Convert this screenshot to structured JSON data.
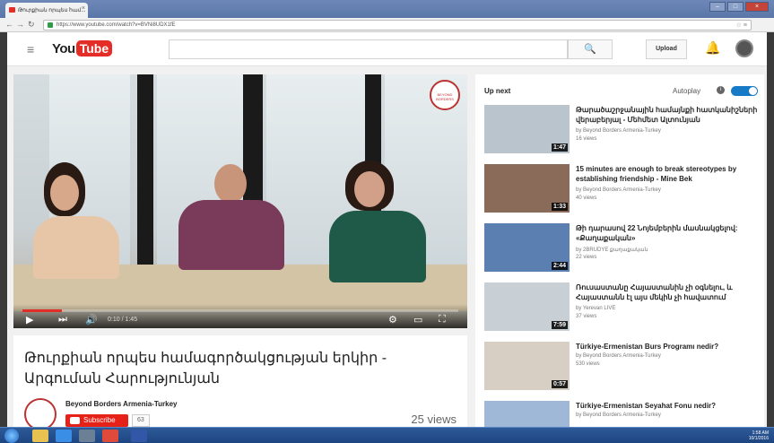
{
  "browser": {
    "tab_title": "Թուրքիան որպես համ...",
    "tab_close": "×",
    "url": "https://www.youtube.com/watch?v=BVNi8UDX1fE",
    "back_icon": "arrow-left-icon",
    "forward_icon": "arrow-right-icon",
    "reload_icon": "reload-icon",
    "window_controls": [
      "–",
      "□",
      "×"
    ]
  },
  "masthead": {
    "logo_you": "You",
    "logo_tube": "Tube",
    "search_placeholder": "",
    "search_icon": "🔍",
    "upload_label": "Upload",
    "bell_icon": "🔔"
  },
  "player": {
    "timecode": "0:10 / 1:45",
    "progress_fraction": 0.09,
    "watermark_text": "BEYOND BORDERS"
  },
  "video": {
    "title": "Թուրքիան որպես համագործակցության երկիր - Արգուման Հարությունյան",
    "channel_name": "Beyond Borders Armenia-Turkey",
    "subscribe_label": "Subscribe",
    "subscriber_count": "63",
    "views": "25 views"
  },
  "sidebar": {
    "upnext_label": "Up next",
    "autoplay_label": "Autoplay",
    "autoplay_on": true,
    "info_symbol": "i",
    "recommendations": [
      {
        "title": "Թարածաշրջանային համայնքի հատկանիշների վերաբերյալ - Մեհմետ Ալտունյան",
        "channel": "by Beyond Borders Armenia-Turkey",
        "views": "16 views",
        "duration": "1:47",
        "thumb_color": "#b9c4cc"
      },
      {
        "title": "15 minutes are enough to break stereotypes by establishing friendship - Mine Bek",
        "channel": "by Beyond Borders Armenia-Turkey",
        "views": "40 views",
        "duration": "1:33",
        "thumb_color": "#8a6a58"
      },
      {
        "title": "Թի դարասով 22 Նոյեմբերին մասնակցելով: «Քաղաքական»",
        "channel": "by 2BRUDYE քաղաքական",
        "views": "22 views",
        "duration": "2:44",
        "thumb_color": "#5a7fb0"
      },
      {
        "title": "Ռուսաստանը Հայաստանին չի օգնելու, և Հայաստանն էլ այս մեկին չի հավատում",
        "channel": "by Yerevan LIVE",
        "views": "37 views",
        "duration": "7:59",
        "thumb_color": "#c8d0d6"
      },
      {
        "title": "Türkiye-Ermenistan Burs Programı nedir?",
        "channel": "by Beyond Borders Armenia-Turkey",
        "views": "530 views",
        "duration": "0:57",
        "thumb_color": "#d8cfc4"
      },
      {
        "title": "Türkiye-Ermenistan Seyahat Fonu nedir?",
        "channel": "by Beyond Borders Armenia-Turkey",
        "views": "",
        "duration": "",
        "thumb_color": "#9fb8d8"
      }
    ]
  },
  "taskbar": {
    "clock_time": "1:58 AM",
    "clock_date": "10/1/2016"
  }
}
